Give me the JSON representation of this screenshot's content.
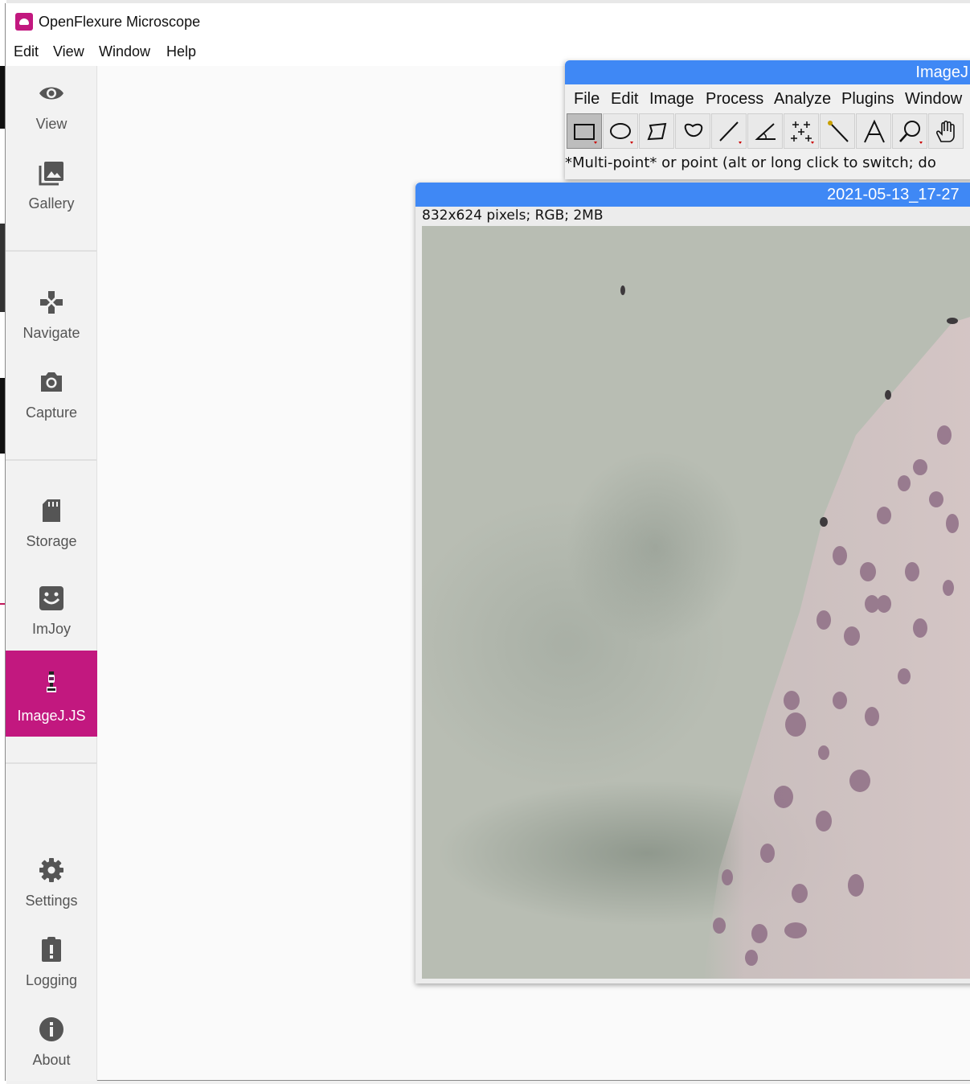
{
  "app": {
    "title": "OpenFlexure Microscope",
    "menu": [
      "Edit",
      "View",
      "Window",
      "Help"
    ]
  },
  "sidebar": {
    "items": [
      {
        "label": "View",
        "icon": "eye-icon"
      },
      {
        "label": "Gallery",
        "icon": "gallery-icon"
      },
      {
        "label": "Navigate",
        "icon": "navigate-icon"
      },
      {
        "label": "Capture",
        "icon": "camera-icon"
      },
      {
        "label": "Storage",
        "icon": "sd-card-icon"
      },
      {
        "label": "ImJoy",
        "icon": "imjoy-smile-icon"
      },
      {
        "label": "ImageJ.JS",
        "icon": "microscope-icon"
      },
      {
        "label": "Settings",
        "icon": "gear-icon"
      },
      {
        "label": "Logging",
        "icon": "clipboard-alert-icon"
      },
      {
        "label": "About",
        "icon": "info-icon"
      }
    ],
    "active": "ImageJ.JS",
    "accent_color": "#c2187f"
  },
  "imagej": {
    "title": "ImageJ",
    "menu": [
      "File",
      "Edit",
      "Image",
      "Process",
      "Analyze",
      "Plugins",
      "Window"
    ],
    "tools": [
      "rectangle-tool-icon",
      "oval-tool-icon",
      "polygon-tool-icon",
      "freehand-tool-icon",
      "line-tool-icon",
      "angle-tool-icon",
      "multipoint-tool-icon",
      "wand-tool-icon",
      "text-tool-icon",
      "magnifier-tool-icon",
      "hand-tool-icon"
    ],
    "status": "*Multi-point* or point (alt or long click to switch; do"
  },
  "image_window": {
    "title": "2021-05-13_17-27",
    "info": "832x624 pixels; RGB; 2MB"
  },
  "colors": {
    "titlebar_blue": "#3f88f5",
    "accent": "#c2187f"
  }
}
